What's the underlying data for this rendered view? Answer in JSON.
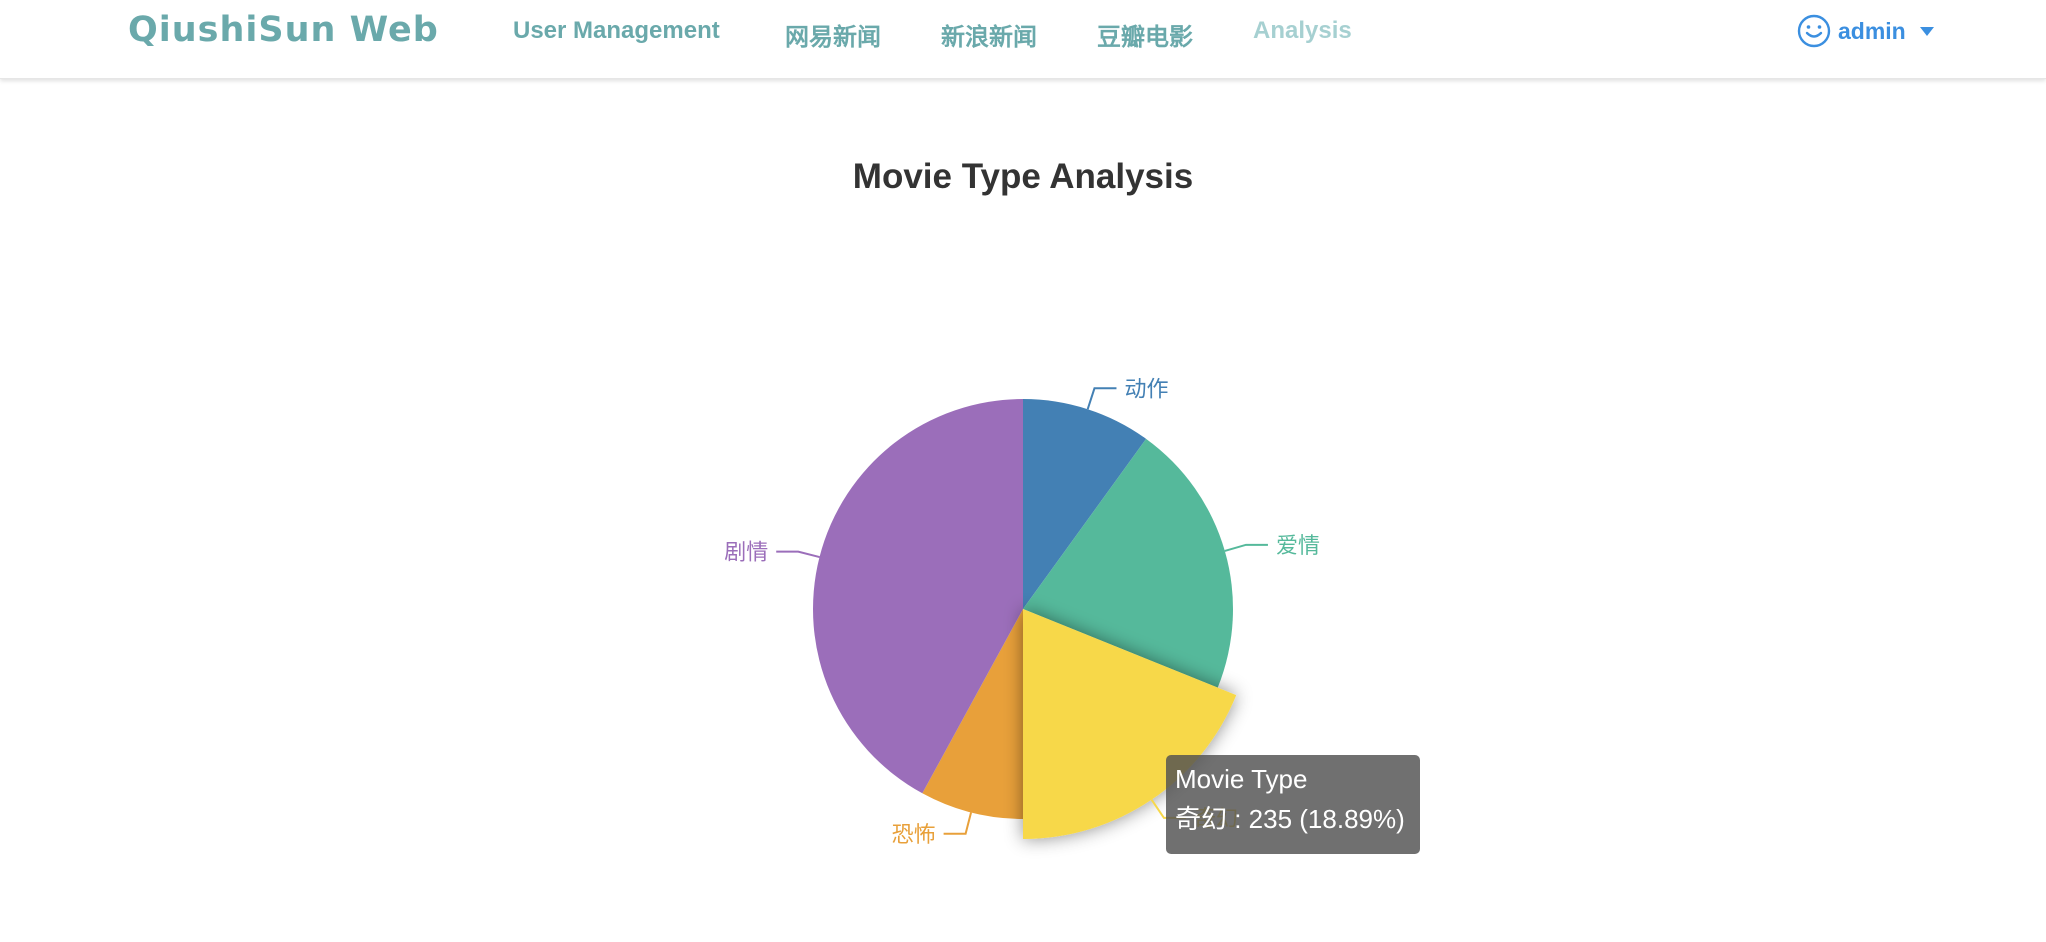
{
  "navbar": {
    "brand": "QiushiSun Web",
    "items": [
      {
        "label": "User Management",
        "active": false
      },
      {
        "label": "网易新闻",
        "active": false
      },
      {
        "label": "新浪新闻",
        "active": false
      },
      {
        "label": "豆瓣电影",
        "active": false
      },
      {
        "label": "Analysis",
        "active": true
      }
    ],
    "user": {
      "name": "admin",
      "icon": "smile-icon"
    }
  },
  "colors": {
    "brand": "#6aa9ab",
    "user": "#3b8fe0"
  },
  "chart_data": {
    "type": "pie",
    "title": "Movie Type Analysis",
    "series_name": "Movie Type",
    "slices": [
      {
        "name": "动作",
        "value": 124,
        "color": "#4380b4"
      },
      {
        "name": "爱情",
        "value": 263,
        "color": "#55b99b"
      },
      {
        "name": "奇幻",
        "value": 235,
        "color": "#f7d84a",
        "highlighted": true
      },
      {
        "name": "恐怖",
        "value": 99,
        "color": "#e8a03a"
      },
      {
        "name": "剧情",
        "value": 523,
        "color": "#9b6eba"
      }
    ]
  },
  "tooltip": {
    "title": "Movie Type",
    "text": "奇幻 : 235 (18.89%)"
  }
}
